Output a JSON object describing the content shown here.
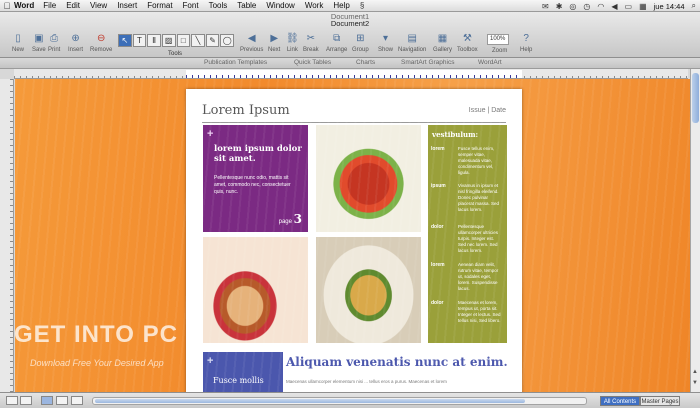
{
  "menubar": {
    "app": "Word",
    "items": [
      "File",
      "Edit",
      "View",
      "Insert",
      "Format",
      "Font",
      "Tools",
      "Table",
      "Window",
      "Work",
      "Help"
    ],
    "clock": "jue 14:44"
  },
  "window": {
    "title_behind": "Document1",
    "title": "Document2"
  },
  "toolbar": {
    "new": "New",
    "save": "Save",
    "print": "Print",
    "insert": "Insert",
    "remove": "Remove",
    "tools": "Tools",
    "previous": "Previous",
    "next": "Next",
    "link": "Link",
    "break": "Break",
    "arrange": "Arrange",
    "group": "Group",
    "show": "Show",
    "navigation": "Navigation",
    "gallery": "Gallery",
    "toolbox": "Toolbox",
    "zoom_value": "100%",
    "zoom": "Zoom",
    "help": "Help"
  },
  "ribbon": {
    "tabs": [
      "Publication Templates",
      "Quick Tables",
      "Charts",
      "SmartArt Graphics",
      "WordArt"
    ]
  },
  "page": {
    "title": "Lorem Ipsum",
    "issue": "Issue | Date",
    "purple_card": {
      "heading": "lorem ipsum dolor sit amet.",
      "body": "Pellentesque nunc odio, mattis sit amet, commodo nec, consectetuer quis, nunc.",
      "page_label": "page",
      "page_num": "3"
    },
    "olive_card": {
      "heading": "vestibulum:",
      "items": [
        {
          "key": "lorem",
          "text": "Fusce tellus enim, semper vitae, malesuada vitae, condimentum vel, ligula."
        },
        {
          "key": "ipsum",
          "text": "Vivamus in ipsum et nisl fringilla eleifend. Donec pulvinar placerat massa. Sed lacus lorem."
        },
        {
          "key": "dolor",
          "text": "Pellentesque ullamcorper ultricies turpis. Integer est. Sed nec lorem. Sed lacus lorem."
        },
        {
          "key": "lorem",
          "text": "Aenean diam velit, rutrum vitae, tempor ut, sodales eget, lorem. Suspendisse lacus."
        },
        {
          "key": "dolor",
          "text": "Maecenas et lorem, tempus ut, porta sit. Integer et lectus. Sed tellus nisi, Sed libero."
        }
      ]
    },
    "blue_card": {
      "title": "Fusce mollis"
    },
    "headline": "Aliquam venenatis nunc at enim.",
    "sub": "Maecenas ullamcorper elementum nisi ... tellus eros a purus. Maecenas et lorem"
  },
  "watermark": {
    "logo": "GET INTO PC",
    "tagline": "Download Free Your Desired App"
  },
  "statusbar": {
    "all_contents": "All Contents",
    "master_pages": "Master Pages"
  }
}
